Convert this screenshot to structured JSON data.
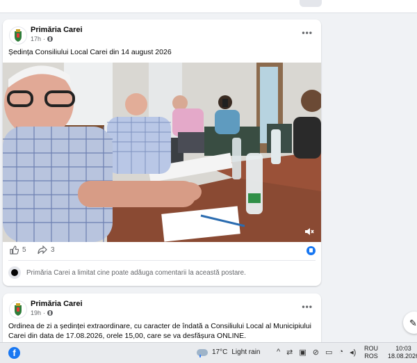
{
  "posts": [
    {
      "author": "Primăria Carei",
      "time": "17h",
      "text": "Ședința Consiliului Local Carei din 14 august 2026",
      "likes": "5",
      "shares": "3",
      "comment_notice": "Primăria Carei a limitat cine poate adăuga comentarii la această postare."
    },
    {
      "author": "Primăria Carei",
      "time": "19h",
      "text": "Ordinea de zi a ședinței extraordinare, cu caracter de îndată a Consiliului Local al Municipiului Carei din data de 17.08.2026, orele 15,00, care se va desfășura ONLINE."
    }
  ],
  "taskbar": {
    "weather_temp": "17°C",
    "weather_desc": "Light rain",
    "lang_1": "ROU",
    "lang_2": "ROS",
    "time": "10:03",
    "date": "18.08.2026"
  },
  "colors": {
    "accent": "#1877f2",
    "page_bg": "#f0f2f5",
    "secondary_text": "#65676b"
  }
}
